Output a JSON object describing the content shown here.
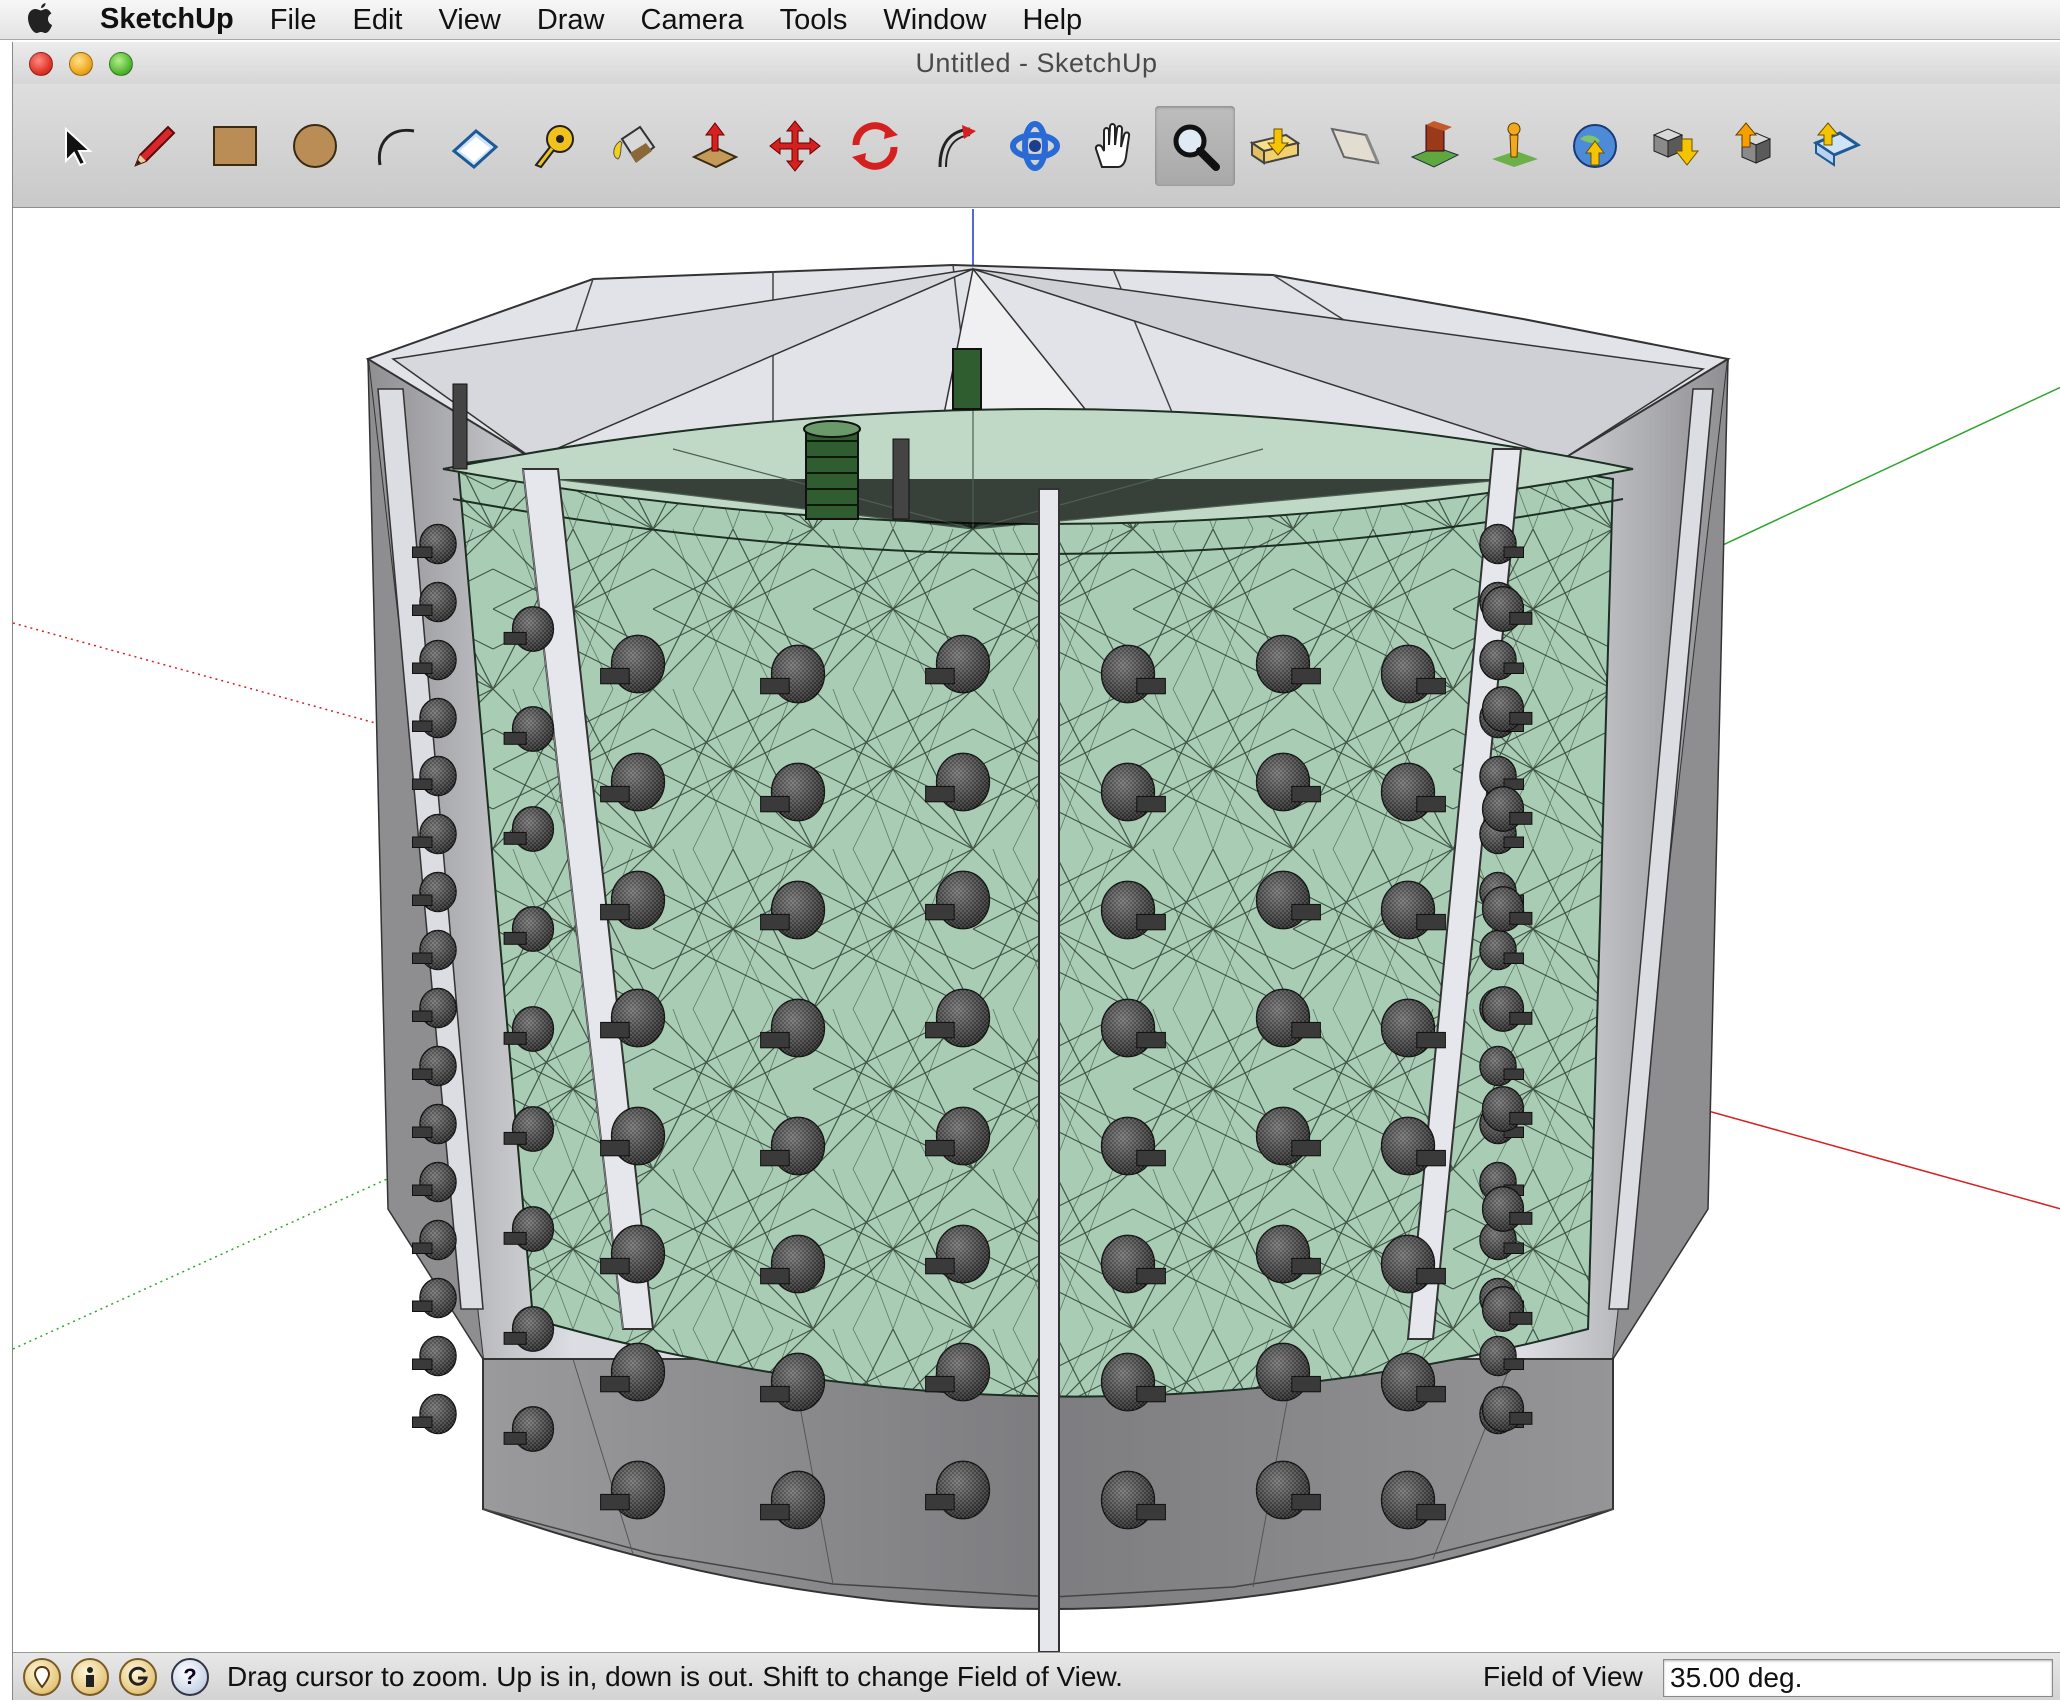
{
  "menubar": {
    "app_name": "SketchUp",
    "items": [
      "File",
      "Edit",
      "View",
      "Draw",
      "Camera",
      "Tools",
      "Window",
      "Help"
    ]
  },
  "window": {
    "title": "Untitled - SketchUp"
  },
  "toolbar": {
    "tools": [
      {
        "name": "select-tool",
        "icon": "arrow-cursor-icon"
      },
      {
        "name": "pencil-tool",
        "icon": "pencil-icon"
      },
      {
        "name": "rectangle-tool",
        "icon": "rectangle-icon"
      },
      {
        "name": "circle-tool",
        "icon": "circle-icon"
      },
      {
        "name": "arc-tool",
        "icon": "arc-icon"
      },
      {
        "name": "eraser-tool",
        "icon": "eraser-icon"
      },
      {
        "name": "tape-measure-tool",
        "icon": "tape-measure-icon"
      },
      {
        "name": "paint-bucket-tool",
        "icon": "paint-bucket-icon"
      },
      {
        "name": "push-pull-tool",
        "icon": "push-pull-icon"
      },
      {
        "name": "move-tool",
        "icon": "move-icon"
      },
      {
        "name": "rotate-tool",
        "icon": "rotate-icon"
      },
      {
        "name": "follow-me-tool",
        "icon": "follow-me-icon"
      },
      {
        "name": "orbit-tool",
        "icon": "orbit-icon"
      },
      {
        "name": "pan-tool",
        "icon": "hand-icon"
      },
      {
        "name": "zoom-tool",
        "icon": "magnifier-icon",
        "active": true
      },
      {
        "name": "get-models-tool",
        "icon": "get-models-icon"
      },
      {
        "name": "section-plane-tool",
        "icon": "section-plane-icon"
      },
      {
        "name": "add-location-tool",
        "icon": "add-location-icon"
      },
      {
        "name": "toggle-terrain-tool",
        "icon": "terrain-icon"
      },
      {
        "name": "preview-google-earth-tool",
        "icon": "google-earth-icon"
      },
      {
        "name": "get-photo-texture-tool",
        "icon": "download-models-icon"
      },
      {
        "name": "share-model-tool",
        "icon": "share-model-icon"
      },
      {
        "name": "share-component-tool",
        "icon": "share-component-icon"
      }
    ]
  },
  "statusbar": {
    "icons": [
      "geo-location-icon",
      "credits-icon",
      "google-icon",
      "help-icon"
    ],
    "help_glyph": "?",
    "message": "Drag cursor to zoom.  Up is in, down is out. Shift to change Field of View.",
    "vcb_label": "Field of View",
    "vcb_value": "35.00 deg."
  },
  "colors": {
    "tank_glass": "#a9cdb4",
    "panel": "#e8e9ee",
    "base": "#8e8e90",
    "axis_red": "#d62020",
    "axis_green": "#2ea62e",
    "axis_blue": "#2233cc"
  }
}
